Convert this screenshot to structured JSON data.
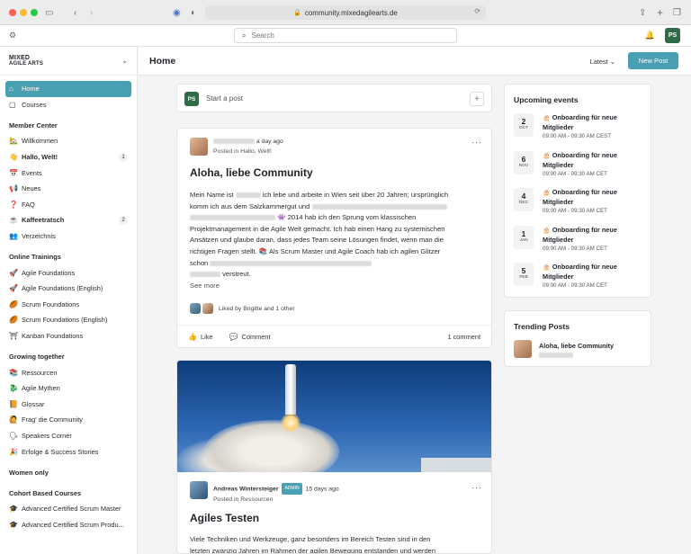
{
  "browser": {
    "url": "community.mixedagilearts.de"
  },
  "topbar": {
    "search_placeholder": "Search",
    "user_initials": "PS"
  },
  "sidebar": {
    "logo_line1": "MIXED",
    "logo_line2": "AGILE ARTS",
    "home": "Home",
    "courses": "Courses",
    "sections": [
      {
        "heading": "Member Center",
        "items": [
          {
            "icon": "🏡",
            "label": "Willkommen",
            "bold": false,
            "badge": ""
          },
          {
            "icon": "👋",
            "label": "Hallo, Welt!",
            "bold": true,
            "badge": "1"
          },
          {
            "icon": "📅",
            "label": "Events",
            "bold": false,
            "badge": ""
          },
          {
            "icon": "📢",
            "label": "Neues",
            "bold": false,
            "badge": ""
          },
          {
            "icon": "❓",
            "label": "FAQ",
            "bold": false,
            "badge": ""
          },
          {
            "icon": "☕",
            "label": "Kaffeetratsch",
            "bold": true,
            "badge": "2"
          },
          {
            "icon": "👥",
            "label": "Verzeichnis",
            "bold": false,
            "badge": ""
          }
        ]
      },
      {
        "heading": "Online Trainings",
        "items": [
          {
            "icon": "🚀",
            "label": "Agile Foundations",
            "bold": false,
            "badge": ""
          },
          {
            "icon": "🚀",
            "label": "Agile Foundations (English)",
            "bold": false,
            "badge": ""
          },
          {
            "icon": "🏉",
            "label": "Scrum Foundations",
            "bold": false,
            "badge": ""
          },
          {
            "icon": "🏉",
            "label": "Scrum Foundations (English)",
            "bold": false,
            "badge": ""
          },
          {
            "icon": "⛩",
            "label": "Kanban Foundations",
            "bold": false,
            "badge": ""
          }
        ]
      },
      {
        "heading": "Growing together",
        "items": [
          {
            "icon": "📚",
            "label": "Ressourcen",
            "bold": false,
            "badge": ""
          },
          {
            "icon": "🐉",
            "label": "Agile Mythen",
            "bold": false,
            "badge": ""
          },
          {
            "icon": "📙",
            "label": "Glossar",
            "bold": false,
            "badge": ""
          },
          {
            "icon": "🙋",
            "label": "Frag' die Community",
            "bold": false,
            "badge": ""
          },
          {
            "icon": "🗣",
            "label": "Speakers Corner",
            "bold": false,
            "badge": ""
          },
          {
            "icon": "🎉",
            "label": "Erfolge & Success Stories",
            "bold": false,
            "badge": ""
          }
        ]
      },
      {
        "heading": "Women only",
        "items": []
      },
      {
        "heading": "Cohort Based Courses",
        "items": [
          {
            "icon": "🎓",
            "label": "Advanced Certified Scrum Master",
            "bold": false,
            "badge": ""
          },
          {
            "icon": "🎓",
            "label": "Advanced Certified Scrum Produ...",
            "bold": false,
            "badge": ""
          }
        ]
      }
    ]
  },
  "header": {
    "title": "Home",
    "sort": "Latest",
    "new_post": "New Post"
  },
  "composer": {
    "initials": "PS",
    "placeholder": "Start a post"
  },
  "post1": {
    "time": "a day ago",
    "posted_in": "Posted in Hallo, Welt!",
    "title": "Aloha, liebe Community",
    "line1a": "Mein Name ist",
    "line1b": "ich lebe und arbeite in Wien seit über 20 Jahren; ursprünglich",
    "line2": "komm ich aus dem Salzkammergut und",
    "line3": "👾 2014 hab ich den Sprung vom klassischen",
    "line4": "Projektmanagement in die Agile Welt gemacht. Ich hab einen Hang zu systemischen",
    "line5": "Ansätzen und glaube daran, dass jedes Team seine Lösungen findet, wenn man die",
    "line6": "richtigen Fragen stellt. 📚 Als Scrum Master und Agile Coach hab ich agilen Glitzer",
    "line7": "schon",
    "line8": "verstreut.",
    "see_more": "See more",
    "liked_by": "Liked by Brigitte and 1 other",
    "like": "Like",
    "comment": "Comment",
    "comment_count": "1 comment"
  },
  "post2": {
    "author": "Andreas Wintersteiger",
    "badge": "ADMIN",
    "time": "15 days ago",
    "posted_in": "Posted in Ressourcen",
    "title": "Agiles Testen",
    "line1": "Viele Techniken und Werkzeuge, ganz besonders im Bereich Testen sind in den",
    "line2": "letzten zwanzig Jahren im Rahmen der agilen Bewegung entstanden und werden"
  },
  "events": {
    "title": "Upcoming events",
    "items": [
      {
        "day": "2",
        "month": "OCT",
        "title": "Onboarding für neue Mitglieder",
        "time": "09:00 AM - 09:30 AM CEST"
      },
      {
        "day": "6",
        "month": "NOV",
        "title": "Onboarding für neue Mitglieder",
        "time": "09:00 AM - 09:30 AM CET"
      },
      {
        "day": "4",
        "month": "DEC",
        "title": "Onboarding für neue Mitglieder",
        "time": "09:00 AM - 09:30 AM CET"
      },
      {
        "day": "1",
        "month": "JAN",
        "title": "Onboarding für neue Mitglieder",
        "time": "09:00 AM - 09:30 AM CET"
      },
      {
        "day": "5",
        "month": "FEB",
        "title": "Onboarding für neue Mitglieder",
        "time": "09:00 AM - 09:30 AM CET"
      }
    ]
  },
  "trending": {
    "title": "Trending Posts",
    "item": "Aloha, liebe Community"
  },
  "colors": {
    "accent": "#4aa0b3",
    "avatar_green": "#2e6b46"
  }
}
